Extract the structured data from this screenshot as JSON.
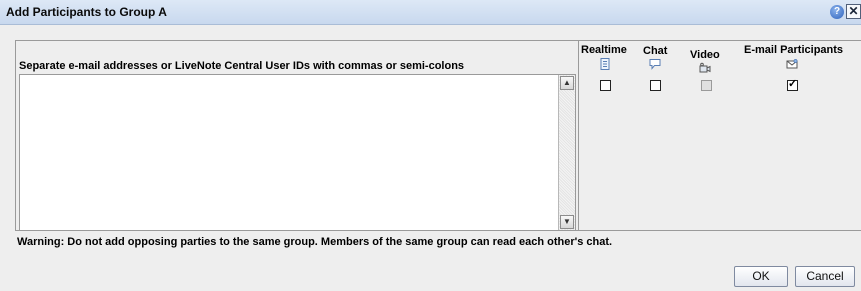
{
  "dialog": {
    "title": "Add Participants to Group A",
    "help_glyph": "?",
    "close_glyph": "✕"
  },
  "form": {
    "instruction": "Separate e-mail addresses or LiveNote Central User IDs with commas or semi-colons",
    "textarea_value": ""
  },
  "columns": [
    {
      "label": "Realtime",
      "icon": "document-icon",
      "checked": false,
      "enabled": true
    },
    {
      "label": "Chat",
      "icon": "speech-bubble-icon",
      "checked": false,
      "enabled": true
    },
    {
      "label": "Video",
      "icon": "video-camera-icon",
      "checked": false,
      "enabled": false
    },
    {
      "label": "E-mail Participants",
      "icon": "email-icon",
      "checked": true,
      "enabled": true
    }
  ],
  "warning": "Warning: Do not add opposing parties to the same group. Members of the same group can read each other's chat.",
  "buttons": {
    "ok": "OK",
    "cancel": "Cancel"
  },
  "colors": {
    "titlebar": "#c8d8ee",
    "panel": "#eeeeee",
    "help": "#2e62bc"
  }
}
